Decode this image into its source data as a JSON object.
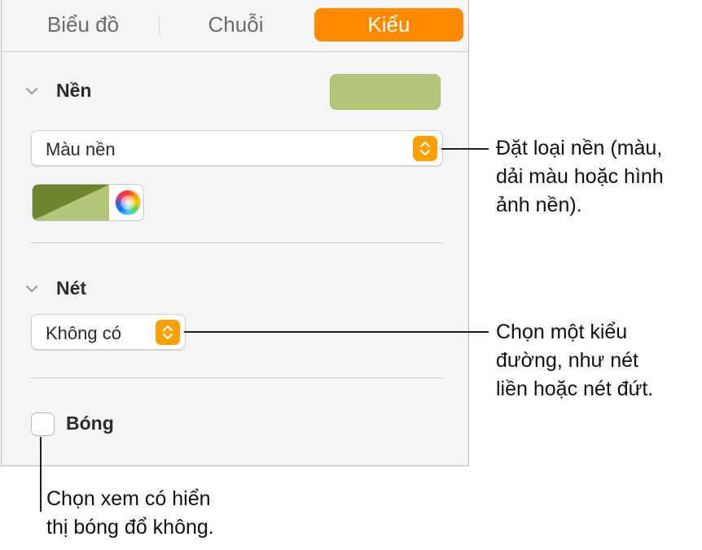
{
  "tabs": [
    {
      "label": "Biểu đồ",
      "active": false
    },
    {
      "label": "Chuỗi",
      "active": false
    },
    {
      "label": "Kiểu",
      "active": true
    }
  ],
  "background_section": {
    "title": "Nền",
    "swatch_color": "#b3c67a",
    "fill_type": "Màu nền",
    "fill_colors": {
      "dark": "#6e8530",
      "light": "#b3c67a"
    }
  },
  "stroke_section": {
    "title": "Nét",
    "value": "Không có"
  },
  "shadow": {
    "label": "Bóng",
    "checked": false
  },
  "callouts": {
    "fill_type": [
      "Đặt loại nền (màu,",
      "dải màu hoặc hình",
      "ảnh nền)."
    ],
    "stroke": [
      "Chọn một kiểu",
      "đường, như nét",
      "liền hoặc nét đứt."
    ],
    "shadow": [
      "Chọn xem có hiển",
      "thị bóng đổ không."
    ]
  },
  "colors": {
    "accent": "#ff8a00",
    "stepper": "#ffa000"
  }
}
